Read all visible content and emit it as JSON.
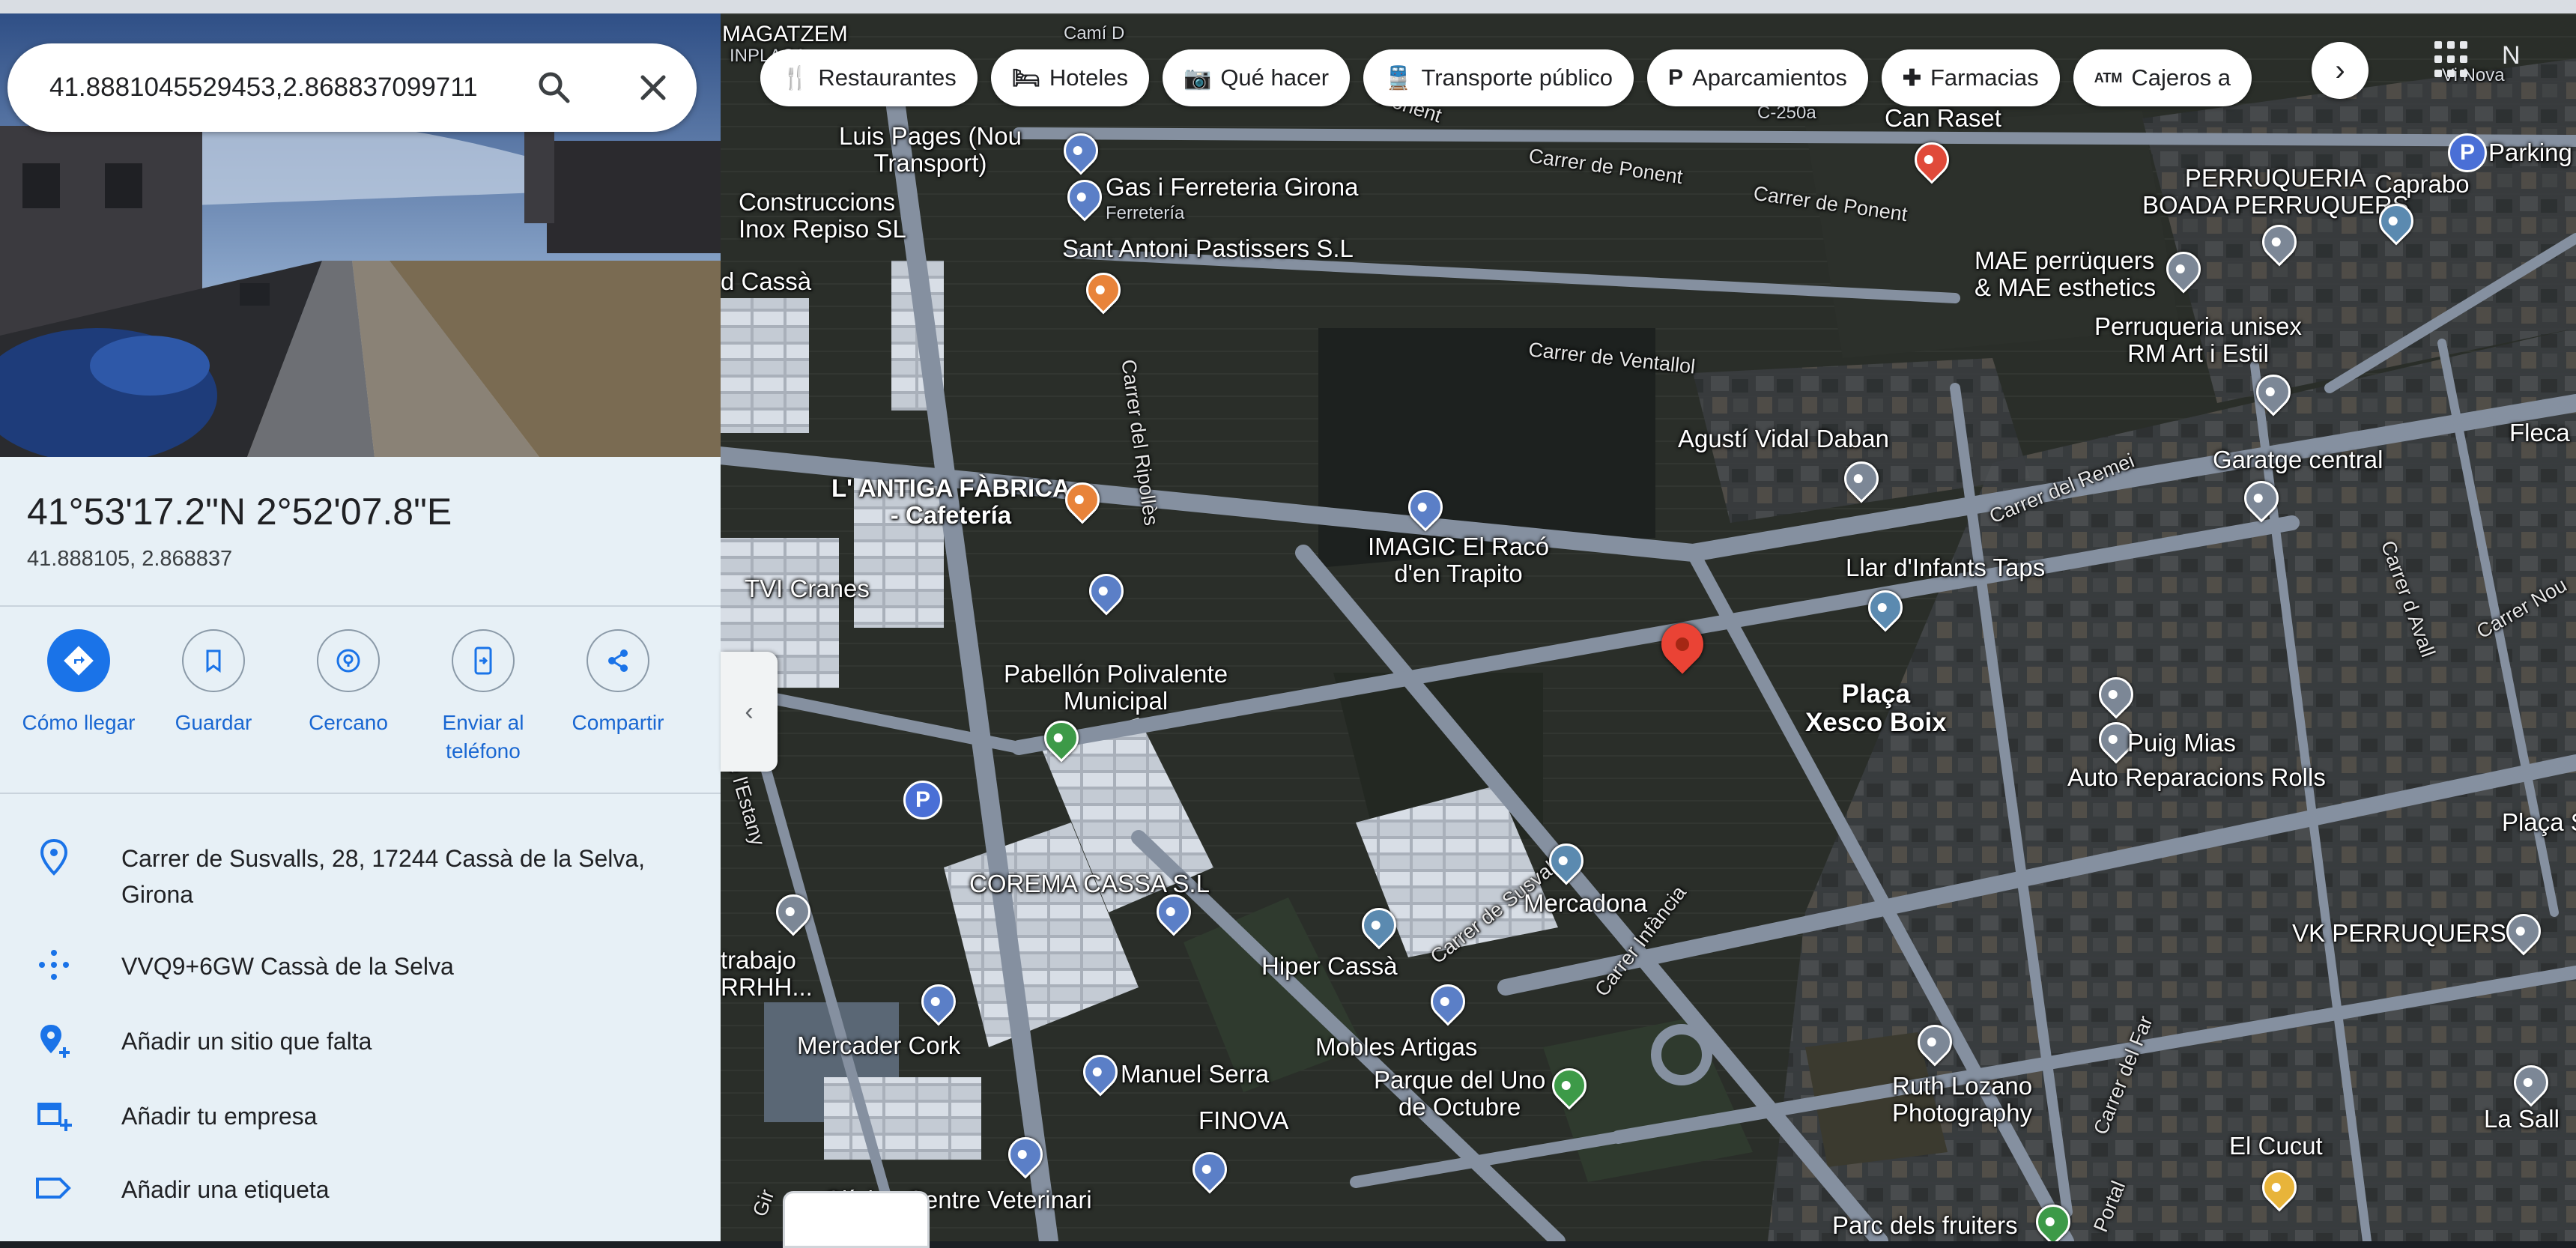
{
  "search": {
    "value": "41.8881045529453,2.868837099711",
    "search_icon": "search-icon",
    "close_icon": "close-icon"
  },
  "chips": [
    {
      "icon": "restaurant-icon",
      "label": "Restaurantes"
    },
    {
      "icon": "hotel-icon",
      "label": "Hoteles"
    },
    {
      "icon": "camera-icon",
      "label": "Qué hacer"
    },
    {
      "icon": "transit-icon",
      "label": "Transporte público"
    },
    {
      "icon": "parking-icon",
      "label": "Aparcamientos"
    },
    {
      "icon": "pharmacy-icon",
      "label": "Farmacias"
    },
    {
      "icon": "atm-icon",
      "label": "Cajeros a"
    }
  ],
  "place": {
    "coords_dms": "41°53'17.2\"N 2°52'07.8\"E",
    "coords_decimal": "41.888105, 2.868837"
  },
  "actions": [
    {
      "icon": "directions-icon",
      "label": "Cómo llegar"
    },
    {
      "icon": "bookmark-icon",
      "label": "Guardar"
    },
    {
      "icon": "nearby-icon",
      "label": "Cercano"
    },
    {
      "icon": "send-to-phone-icon",
      "label": "Enviar al teléfono"
    },
    {
      "icon": "share-icon",
      "label": "Compartir"
    }
  ],
  "info": {
    "address_line1": "Carrer de Susvalls, 28, 17244 Cassà de la Selva,",
    "address_line2": "Girona",
    "plus_code": "VVQ9+6GW Cassà de la Selva",
    "add_place": "Añadir un sitio que falta",
    "add_business": "Añadir tu empresa",
    "add_label": "Añadir una etiqueta"
  },
  "map_labels": {
    "magatzem": "MAGATZEM",
    "inplaca": "INPLACA",
    "camid": "Camí D",
    "luis_pages_1": "Luis Pages (Nou",
    "luis_pages_2": "Transport)",
    "gas_ferreteria": "Gas i Ferreteria Girona",
    "ferreteria": "Ferretería",
    "construccions_1": "Construccions",
    "construccions_2": "Inox Repiso SL",
    "sant_antoni": "Sant Antoni Pastissers S.L",
    "dcassa": "d Cassà",
    "carrer_ripolles": "Carrer del Ripollès",
    "ponent_top": "Ponent",
    "carrer_ponent_1": "Carrer de Ponent",
    "carrer_ponent_2": "Carrer de Ponent",
    "c250a": "C-250a",
    "can_raset": "Can Raset",
    "perruqueria_1": "PERRUQUERIA",
    "perruqueria_2": "BOADA PERRUQUERS",
    "caprabo": "Caprabo",
    "parking": "Parking c",
    "vinova": "Vi Nova",
    "mae_1": "MAE perrüquers",
    "mae_2": "& MAE esthetics",
    "unisex_1": "Perruqueria unisex",
    "unisex_2": "RM Art i Estil",
    "carrer_ventallol": "Carrer de Ventallol",
    "agusti": "Agustí Vidal Daban",
    "flecar": "Fleca",
    "garatge": "Garatge central",
    "carrer_avall": "Carrer d Avall",
    "carrer_nou": "Carrer Nou",
    "antiga_1": "L' ANTIGA FÀBRICA",
    "antiga_2": "- Cafetería",
    "carrer_rem": "Carrer del Remei",
    "imagic_1": "IMAGIC El Racó",
    "imagic_2": "d'en Trapito",
    "llar": "Llar d'Infants Taps",
    "tvi": "TVI Cranes",
    "placa_xesco_1": "Plaça",
    "placa_xesco_2": "Xesco Boix",
    "pabellon_1": "Pabellón Polivalente",
    "pabellon_2": "Municipal",
    "puig_1": "Puig Mias",
    "puig_2": "Auto Reparacions Rolls",
    "placa_r": "Plaça S",
    "estany": "de l'Estany",
    "corema": "COREMA CASSA S.L",
    "carrer_susvalls": "Carrer de Susvalls",
    "mercadona": "Mercadona",
    "vk": "VK PERRUQUERS",
    "trabajo_1": "trabajo",
    "trabajo_2": "RRHH...",
    "hiper": "Hiper Cassà",
    "carrer_infancia": "Carrer Infància",
    "mercader": "Mercader Cork",
    "manuel": "Manuel Serra",
    "mobles": "Mobles Artigas",
    "parque_1": "Parque del Uno",
    "parque_2": "de Octubre",
    "ruth_1": "Ruth Lozano",
    "ruth_2": "Photography",
    "carrer_far": "Carrer del Far",
    "lasall": "La Sall",
    "finova": "FINOVA",
    "cucut": "El Cucut",
    "clinica": "Clínica Centre Veterinari",
    "parc_fruiters": "Parc dels fruiters",
    "portal": "Portal",
    "gir": "Gir"
  }
}
